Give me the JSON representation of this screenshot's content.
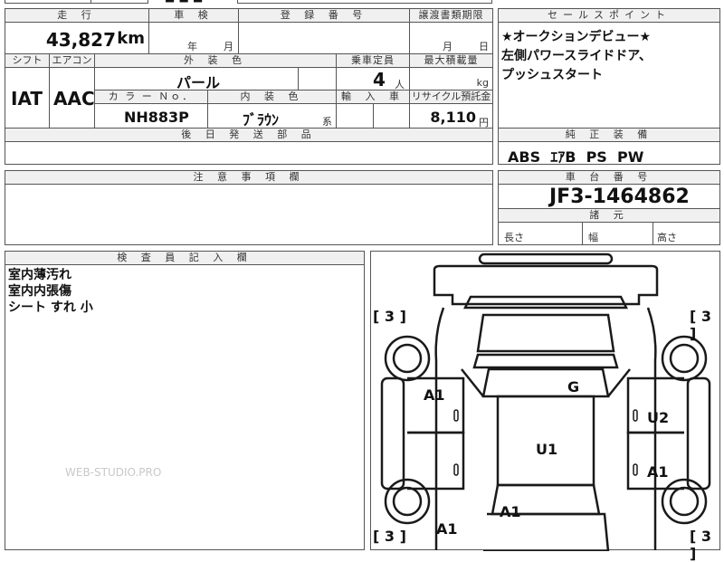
{
  "top_partial": {
    "frag1": "■ ■ ■",
    "frag2": "─ ─"
  },
  "mileage": {
    "header": "走 行",
    "value": "43,827",
    "unit": "km"
  },
  "inspection": {
    "header": "車 検",
    "year_unit": "年",
    "month_unit": "月"
  },
  "registration": {
    "header": "登 録 番 号"
  },
  "transfer_deadline": {
    "header": "譲渡書類期限",
    "month_unit": "月",
    "day_unit": "日"
  },
  "sales_points": {
    "header": "セールスポイント",
    "lines": [
      "★オークションデビュー★",
      "左側パワースライドドア、",
      "プッシュスタート"
    ]
  },
  "shift": {
    "header": "シフト",
    "value": "IAT"
  },
  "aircon": {
    "header": "エアコン",
    "value": "AAC"
  },
  "exterior_color": {
    "header": "外 装 色",
    "value": "パール"
  },
  "capacity": {
    "header": "乗車定員",
    "value": "4",
    "unit": "人"
  },
  "max_load": {
    "header": "最大積載量",
    "unit": "kg"
  },
  "color_no": {
    "header": "カ ラ ー Ｎｏ．",
    "value": "NH883P"
  },
  "interior_color": {
    "header": "内 装 色",
    "value": "ﾌﾞﾗｳﾝ",
    "suffix": "系"
  },
  "import_car": {
    "header": "輸 入 車"
  },
  "recycle_fee": {
    "header": "リサイクル預託金",
    "value": "8,110",
    "unit": "円"
  },
  "later_parts": {
    "header": "後 日 発 送 部 品"
  },
  "standard_equipment": {
    "header": "純 正 装 備",
    "value": "ABS  ｴｱB  PS  PW"
  },
  "caution": {
    "header": "注 意 事 項 欄"
  },
  "chassis_number": {
    "header": "車 台 番 号",
    "value": "JF3-1464862"
  },
  "specs": {
    "header": "諸 元",
    "length": "長さ",
    "width": "幅",
    "height": "高さ"
  },
  "inspector_notes": {
    "header": "検 査 員 記 入 欄",
    "lines": [
      "室内薄汚れ",
      "室内内張傷",
      "シート すれ 小"
    ]
  },
  "watermark": "WEB-STUDIO.PRO",
  "diagram": {
    "tire_marks": [
      {
        "id": "front-left",
        "value": "3"
      },
      {
        "id": "front-right",
        "value": "3"
      },
      {
        "id": "rear-left",
        "value": "3"
      },
      {
        "id": "rear-right",
        "value": "3"
      }
    ],
    "damage_marks": [
      {
        "id": "left-front-door",
        "value": "A1"
      },
      {
        "id": "hood",
        "value": "G"
      },
      {
        "id": "right-front-door",
        "value": "U2"
      },
      {
        "id": "roof",
        "value": "U1"
      },
      {
        "id": "right-rear-door",
        "value": "A1"
      },
      {
        "id": "rear-center",
        "value": "A1"
      },
      {
        "id": "rear-left",
        "value": "A1"
      }
    ],
    "line_color": "#1a1a1a"
  }
}
